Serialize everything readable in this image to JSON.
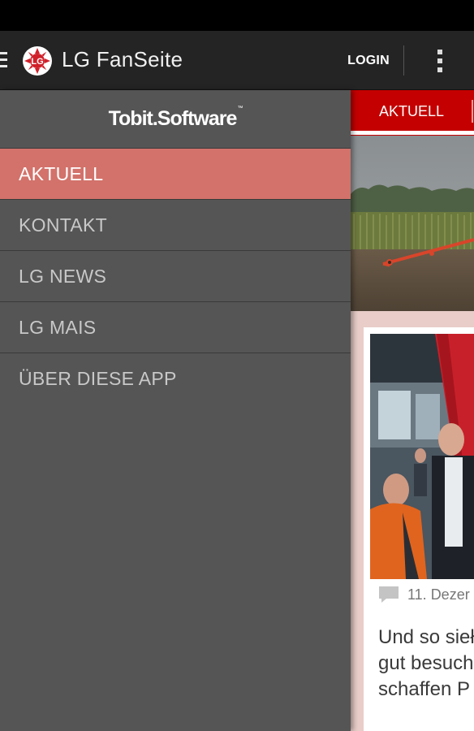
{
  "app": {
    "title": "LG FanSeite",
    "login_label": "LOGIN",
    "brand_color": "#c40000"
  },
  "drawer": {
    "brand_text": "Tobit.Software",
    "brand_tm": "™",
    "items": [
      {
        "label": "AKTUELL",
        "active": true
      },
      {
        "label": "KONTAKT",
        "active": false
      },
      {
        "label": "LG NEWS",
        "active": false
      },
      {
        "label": "LG MAIS",
        "active": false
      },
      {
        "label": "ÜBER DIESE APP",
        "active": false
      }
    ],
    "active_color": "#d2726a"
  },
  "content": {
    "tab_label": "AKTUELL",
    "post": {
      "date": "11. Dezer",
      "text": "Und so sieł\ngut besuch\nschaffen P"
    }
  },
  "icons": {
    "menu": "hamburger-icon",
    "app_logo": "lg-logo-icon",
    "overflow": "overflow-menu-icon",
    "comment": "comment-icon"
  }
}
